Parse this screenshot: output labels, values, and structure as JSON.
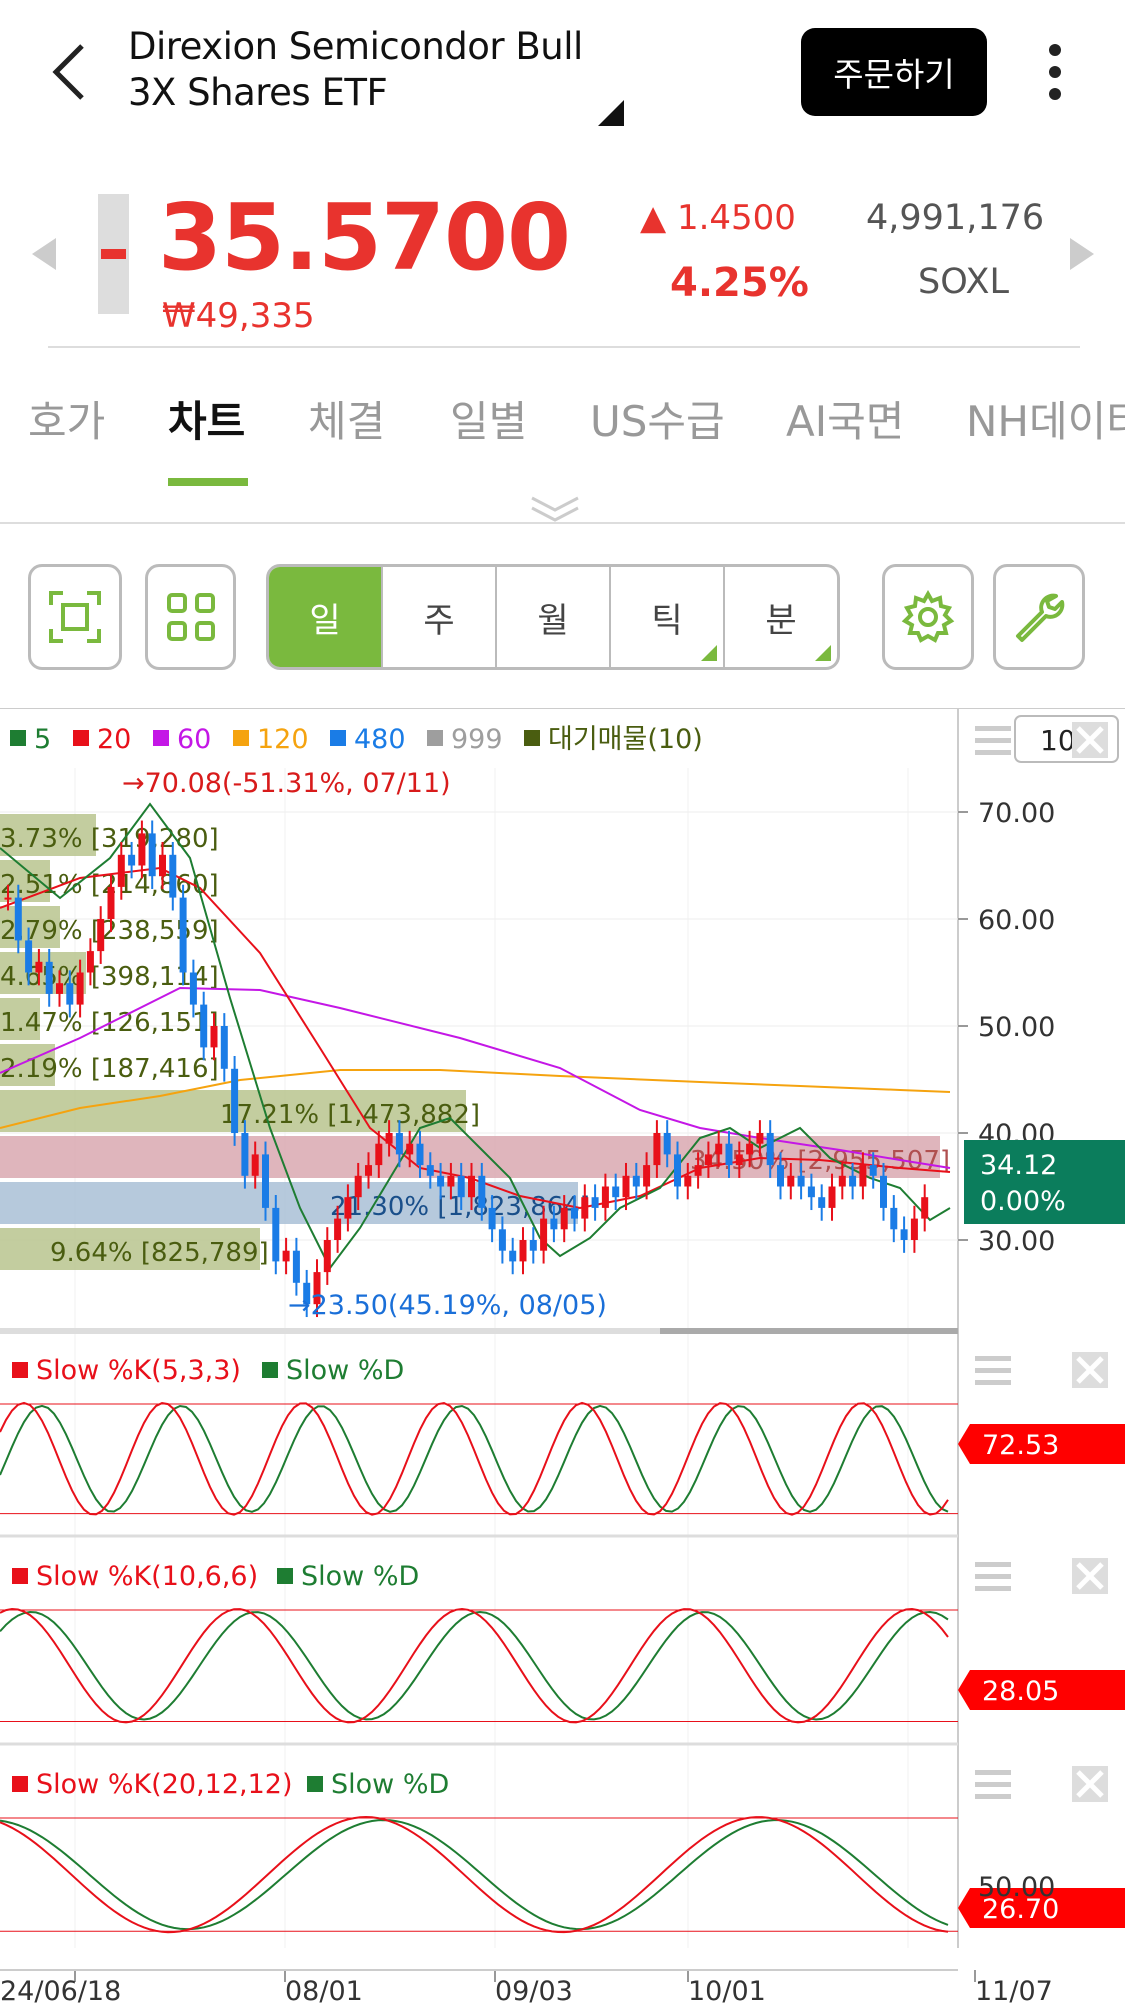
{
  "header": {
    "title_line1": "Direxion Semicondor Bull",
    "title_line2": "3X Shares ETF",
    "order_button": "주문하기"
  },
  "quote": {
    "price": "35.5700",
    "price_krw": "₩49,335",
    "change": "▲ 1.4500",
    "change_pct": "4.25%",
    "volume": "4,991,176",
    "symbol": "SOXL"
  },
  "tabs": [
    "호가",
    "차트",
    "체결",
    "일별",
    "US수급",
    "AI국면",
    "NH데이터"
  ],
  "period_selector": [
    "일",
    "주",
    "월",
    "틱",
    "분"
  ],
  "legend": {
    "ma": [
      {
        "label": "5",
        "color": "#1e7d32"
      },
      {
        "label": "20",
        "color": "#e8101a"
      },
      {
        "label": "60",
        "color": "#c417e6"
      },
      {
        "label": "120",
        "color": "#f5a30f"
      },
      {
        "label": "480",
        "color": "#1a7ce6"
      },
      {
        "label": "999",
        "color": "#9e9e9e"
      },
      {
        "label": "대기매물(10)",
        "color": "#4a5d10"
      }
    ],
    "count_input": "100"
  },
  "main_chart": {
    "y_ticks": [
      "70.00",
      "60.00",
      "50.00",
      "40.00",
      "30.00"
    ],
    "current_price": "34.12",
    "current_pct": "0.00%",
    "high_label": "70.08(-51.31%, 07/11)",
    "low_label": "23.50(45.19%, 08/05)",
    "volume_profile": [
      "3.73% [319,280]",
      "2.51% [214,860]",
      "2.79% [238,559]",
      "4.65% [398,114]",
      "1.47% [126,151]",
      "2.19% [187,416]",
      "17.21% [1,473,882]",
      "34.50% [2,955,507]",
      "21.30% [1,823,864]",
      "9.64% [825,789]"
    ]
  },
  "stochastics": [
    {
      "k_label": "Slow %K(5,3,3)",
      "d_label": "Slow %D",
      "value": "72.53"
    },
    {
      "k_label": "Slow %K(10,6,6)",
      "d_label": "Slow %D",
      "value": "28.05"
    },
    {
      "k_label": "Slow %K(20,12,12)",
      "d_label": "Slow %D",
      "value": "26.70",
      "tick": "50.00"
    }
  ],
  "x_axis": [
    "24/06/18",
    "08/01",
    "09/03",
    "10/01",
    "11/07"
  ]
}
